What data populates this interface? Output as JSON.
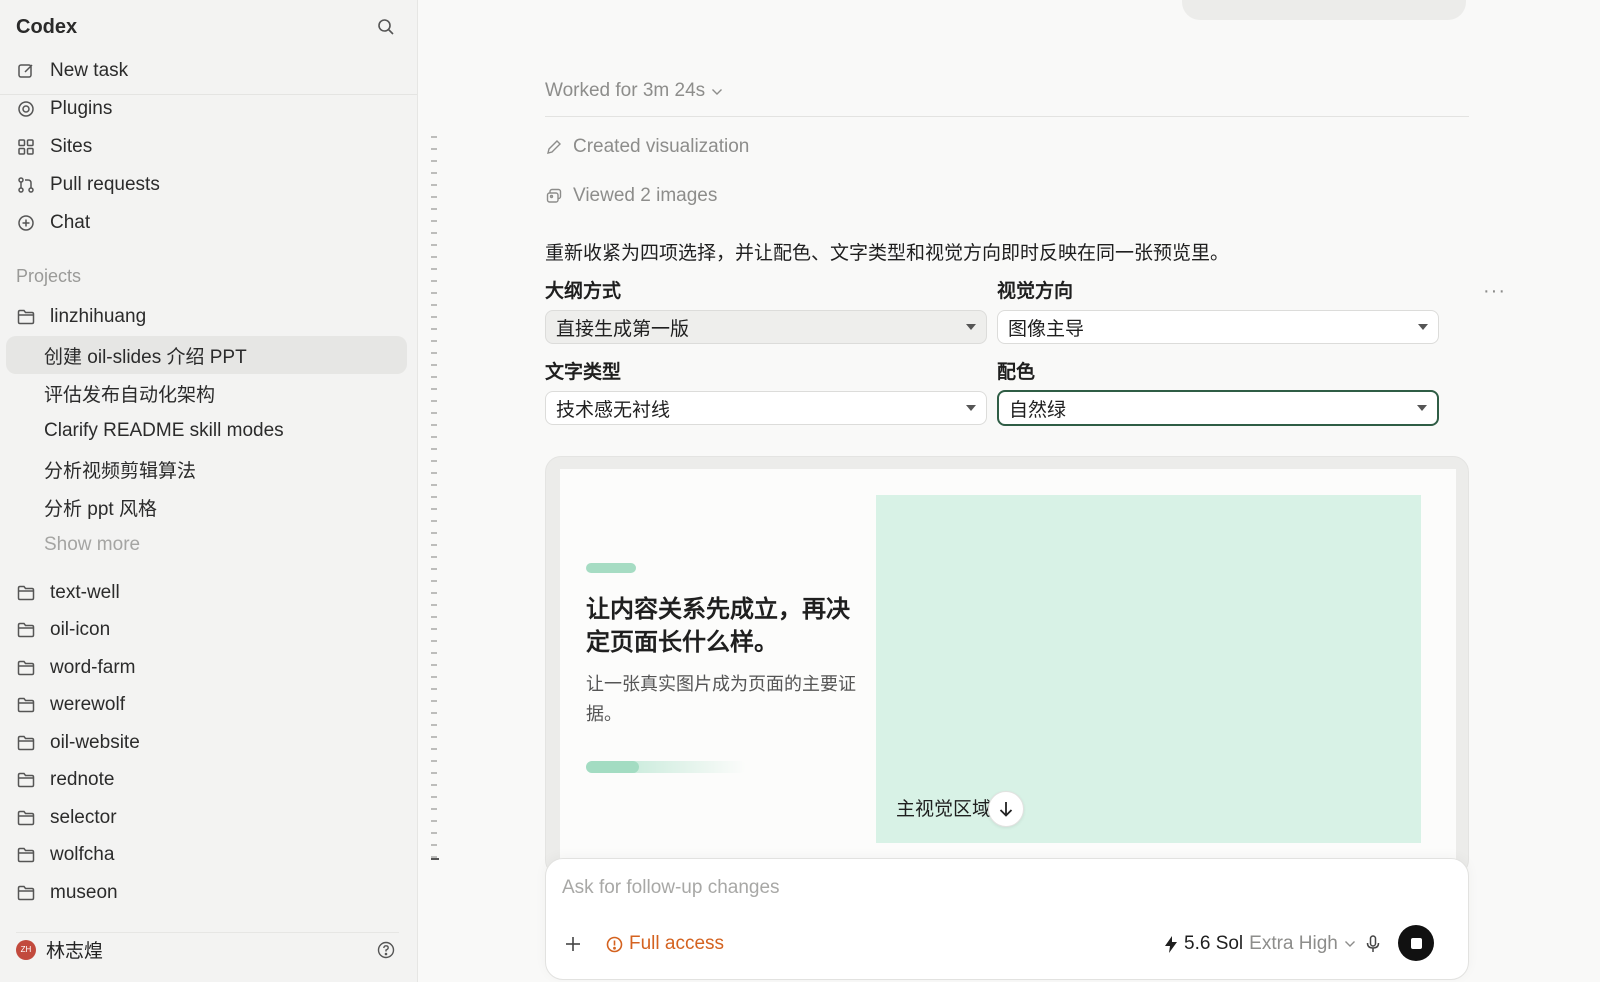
{
  "sidebar": {
    "app_title": "Codex",
    "nav": [
      {
        "label": "New task",
        "icon": "edit-icon"
      },
      {
        "label": "Plugins",
        "icon": "at-icon"
      },
      {
        "label": "Sites",
        "icon": "grid-icon"
      },
      {
        "label": "Pull requests",
        "icon": "pull-request-icon"
      },
      {
        "label": "Chat",
        "icon": "chat-plus-icon"
      }
    ],
    "projects_label": "Projects",
    "current_project": "linzhihuang",
    "tasks": [
      "创建 oil-slides 介绍 PPT",
      "评估发布自动化架构",
      "Clarify README skill modes",
      "分析视频剪辑算法",
      "分析 ppt 风格"
    ],
    "show_more": "Show more",
    "folders": [
      "text-well",
      "oil-icon",
      "word-farm",
      "werewolf",
      "oil-website",
      "rednote",
      "selector",
      "wolfcha",
      "museon"
    ],
    "user": {
      "initials": "ZH",
      "name": "林志煌",
      "avatar_color": "#c24a3d"
    }
  },
  "main": {
    "worked_for": "Worked for 3m 24s",
    "activities": [
      {
        "label": "Created visualization",
        "icon": "pencil-icon"
      },
      {
        "label": "Viewed 2 images",
        "icon": "images-icon"
      }
    ],
    "message": "重新收紧为四项选择，并让配色、文字类型和视觉方向即时反映在同一张预览里。",
    "fields": {
      "outline": {
        "label": "大纲方式",
        "value": "直接生成第一版"
      },
      "visual": {
        "label": "视觉方向",
        "value": "图像主导"
      },
      "text_type": {
        "label": "文字类型",
        "value": "技术感无衬线"
      },
      "palette": {
        "label": "配色",
        "value": "自然绿"
      }
    },
    "preview": {
      "title": "让内容关系先成立，再决定页面长什么样。",
      "subtitle": "让一张真实图片成为页面的主要证据。",
      "visual_label": "主视觉区域",
      "accent_color": "#a6dcc3",
      "visual_color": "#d8f2e6",
      "progress": 0.33
    },
    "composer": {
      "placeholder": "Ask for follow-up changes",
      "access": "Full access",
      "model": "5.6 Sol",
      "effort": "Extra High",
      "access_color": "#d4621f"
    }
  }
}
